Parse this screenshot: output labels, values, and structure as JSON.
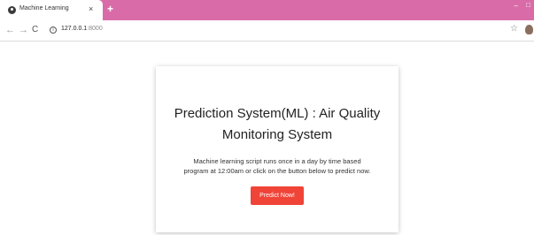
{
  "browser": {
    "tab": {
      "title": "Machine Learning",
      "close_glyph": "×"
    },
    "new_tab_glyph": "+",
    "window_controls": {
      "minimize": "–",
      "maximize": "□"
    },
    "toolbar": {
      "back_glyph": "←",
      "forward_glyph": "→",
      "reload_glyph": "C",
      "info_glyph": "i",
      "url_host": "127.0.0.1",
      "url_port": ":8000",
      "star_glyph": "☆"
    },
    "icons": {
      "favicon": "globe-icon",
      "profile": "avatar-icon"
    },
    "colors": {
      "tabstrip": "#d96ca8"
    }
  },
  "page": {
    "title_line1": "Prediction System(ML) : Air Quality",
    "title_line2": "Monitoring System",
    "description_line1": "Machine learning script runs once in a day by time based",
    "description_line2": "program at 12:00am or click on the button below to predict now.",
    "button_label": "Predict Now!",
    "colors": {
      "button": "#f04438"
    }
  }
}
